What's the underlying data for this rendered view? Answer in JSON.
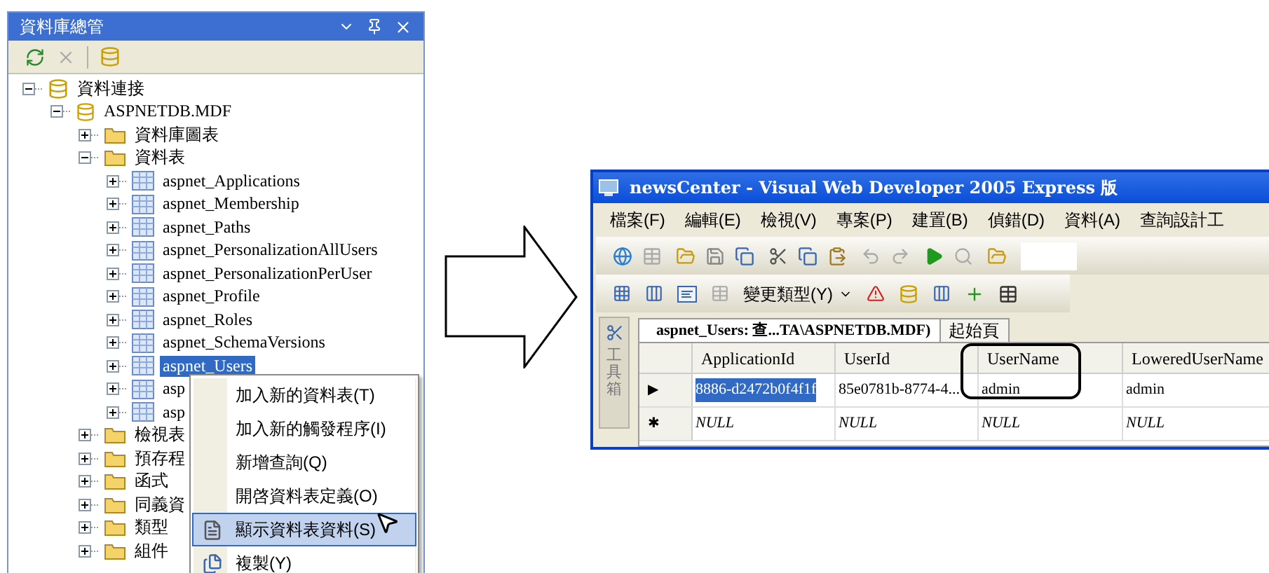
{
  "explorer": {
    "title": "資料庫總管",
    "tree": [
      {
        "label": "資料連接",
        "kind": "connection",
        "expanded": true,
        "selected": false,
        "children": [
          {
            "label": "ASPNETDB.MDF",
            "kind": "database",
            "expanded": true,
            "selected": false,
            "children": [
              {
                "label": "資料庫圖表",
                "kind": "folder",
                "expanded": false,
                "selected": false
              },
              {
                "label": "資料表",
                "kind": "folder",
                "expanded": true,
                "selected": false,
                "children": [
                  {
                    "label": "aspnet_Applications",
                    "kind": "table",
                    "expanded": false,
                    "selected": false
                  },
                  {
                    "label": "aspnet_Membership",
                    "kind": "table",
                    "expanded": false,
                    "selected": false
                  },
                  {
                    "label": "aspnet_Paths",
                    "kind": "table",
                    "expanded": false,
                    "selected": false
                  },
                  {
                    "label": "aspnet_PersonalizationAllUsers",
                    "kind": "table",
                    "expanded": false,
                    "selected": false
                  },
                  {
                    "label": "aspnet_PersonalizationPerUser",
                    "kind": "table",
                    "expanded": false,
                    "selected": false
                  },
                  {
                    "label": "aspnet_Profile",
                    "kind": "table",
                    "expanded": false,
                    "selected": false
                  },
                  {
                    "label": "aspnet_Roles",
                    "kind": "table",
                    "expanded": false,
                    "selected": false
                  },
                  {
                    "label": "aspnet_SchemaVersions",
                    "kind": "table",
                    "expanded": false,
                    "selected": false
                  },
                  {
                    "label": "aspnet_Users",
                    "kind": "table",
                    "expanded": false,
                    "selected": true
                  },
                  {
                    "label": "asp",
                    "kind": "table",
                    "expanded": false,
                    "selected": false
                  },
                  {
                    "label": "asp",
                    "kind": "table",
                    "expanded": false,
                    "selected": false
                  }
                ]
              },
              {
                "label": "檢視表",
                "kind": "folder",
                "expanded": false,
                "selected": false
              },
              {
                "label": "預存程",
                "kind": "folder",
                "expanded": false,
                "selected": false
              },
              {
                "label": "函式",
                "kind": "folder",
                "expanded": false,
                "selected": false
              },
              {
                "label": "同義資",
                "kind": "folder",
                "expanded": false,
                "selected": false
              },
              {
                "label": "類型",
                "kind": "folder",
                "expanded": false,
                "selected": false
              },
              {
                "label": "組件",
                "kind": "folder",
                "expanded": false,
                "selected": false
              }
            ]
          }
        ]
      }
    ]
  },
  "context_menu": {
    "items": [
      {
        "label": "加入新的資料表(T)",
        "selected": false
      },
      {
        "label": "加入新的觸發程序(I)",
        "selected": false
      },
      {
        "label": "新增查詢(Q)",
        "selected": false
      },
      {
        "label": "開啓資料表定義(O)",
        "selected": false
      },
      {
        "label": "顯示資料表資料(S)",
        "selected": true
      },
      {
        "label": "複製(Y)",
        "selected": false
      }
    ]
  },
  "ide": {
    "title": "newsCenter - Visual Web Developer 2005 Express 版",
    "menu": [
      "檔案(F)",
      "編輯(E)",
      "檢視(V)",
      "專案(P)",
      "建置(B)",
      "偵錯(D)",
      "資料(A)",
      "查詢設計工"
    ],
    "change_type": "變更類型(Y)",
    "toolbox": "工具箱",
    "tabs": [
      {
        "label": "aspnet_Users: 查...TA\\ASPNETDB.MDF)",
        "selected": true
      },
      {
        "label": "起始頁",
        "selected": false
      }
    ],
    "table": {
      "columns": [
        "ApplicationId",
        "UserId",
        "UserName",
        "LoweredUserName"
      ],
      "rows": [
        {
          "kind": "data",
          "indicator": "▶",
          "cells": [
            {
              "text": "8886-d2472b0f4f1f",
              "selected": true
            },
            {
              "text": "85e0781b-8774-4...",
              "selected": false
            },
            {
              "text": "admin",
              "selected": false
            },
            {
              "text": "admin",
              "selected": false
            }
          ]
        },
        {
          "kind": "new",
          "indicator": "✱",
          "cells": [
            {
              "text": "NULL",
              "selected": false
            },
            {
              "text": "NULL",
              "selected": false
            },
            {
              "text": "NULL",
              "selected": false
            },
            {
              "text": "NULL",
              "selected": false
            }
          ]
        }
      ]
    }
  }
}
